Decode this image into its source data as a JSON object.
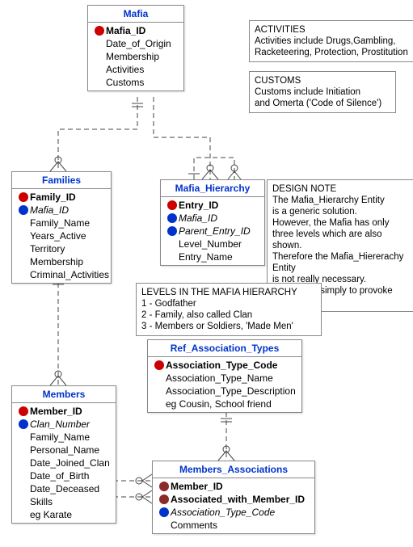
{
  "entities": {
    "mafia": {
      "title": "Mafia",
      "attrs": [
        {
          "key": "pk",
          "name": "Mafia_ID",
          "bold": true
        },
        {
          "key": null,
          "name": "Date_of_Origin"
        },
        {
          "key": null,
          "name": "Membership"
        },
        {
          "key": null,
          "name": "Activities"
        },
        {
          "key": null,
          "name": "Customs"
        }
      ]
    },
    "families": {
      "title": "Families",
      "attrs": [
        {
          "key": "pk",
          "name": "Family_ID",
          "bold": true
        },
        {
          "key": "fk",
          "name": "Mafia_ID",
          "italic": true
        },
        {
          "key": null,
          "name": "Family_Name"
        },
        {
          "key": null,
          "name": "Years_Active"
        },
        {
          "key": null,
          "name": "Territory"
        },
        {
          "key": null,
          "name": "Membership"
        },
        {
          "key": null,
          "name": "Criminal_Activities"
        }
      ]
    },
    "hierarchy": {
      "title": "Mafia_Hierarchy",
      "attrs": [
        {
          "key": "pk",
          "name": "Entry_ID",
          "bold": true
        },
        {
          "key": "fk",
          "name": "Mafia_ID",
          "italic": true
        },
        {
          "key": "fk",
          "name": "Parent_Entry_ID",
          "italic": true
        },
        {
          "key": null,
          "name": "Level_Number"
        },
        {
          "key": null,
          "name": "Entry_Name"
        }
      ]
    },
    "members": {
      "title": "Members",
      "attrs": [
        {
          "key": "pk",
          "name": "Member_ID",
          "bold": true
        },
        {
          "key": "fk",
          "name": "Clan_Number",
          "italic": true
        },
        {
          "key": null,
          "name": "Family_Name"
        },
        {
          "key": null,
          "name": "Personal_Name"
        },
        {
          "key": null,
          "name": "Date_Joined_Clan"
        },
        {
          "key": null,
          "name": "Date_of_Birth"
        },
        {
          "key": null,
          "name": "Date_Deceased"
        },
        {
          "key": null,
          "name": "Skills"
        },
        {
          "key": null,
          "name": "eg Karate"
        }
      ]
    },
    "ref_assoc": {
      "title": "Ref_Association_Types",
      "attrs": [
        {
          "key": "pk",
          "name": "Association_Type_Code",
          "bold": true
        },
        {
          "key": null,
          "name": "Association_Type_Name"
        },
        {
          "key": null,
          "name": "Association_Type_Description"
        },
        {
          "key": null,
          "name": "eg Cousin, School friend"
        }
      ]
    },
    "mem_assoc": {
      "title": "Members_Associations",
      "attrs": [
        {
          "key": "pf",
          "name": "Member_ID",
          "bold": true
        },
        {
          "key": "pf",
          "name": "Associated_with_Member_ID",
          "bold": true
        },
        {
          "key": "fk",
          "name": "Association_Type_Code",
          "italic": true
        },
        {
          "key": null,
          "name": "Comments"
        }
      ]
    }
  },
  "notes": {
    "activities": {
      "title": "ACTIVITIES",
      "lines": [
        "Activities include Drugs,Gambling,",
        "Racketeering, Protection, Prostitution"
      ]
    },
    "customs": {
      "title": "CUSTOMS",
      "lines": [
        "Customs include Initiation",
        "and Omerta ('Code of Silence')"
      ]
    },
    "design": {
      "title": "DESIGN NOTE",
      "lines": [
        "The Mafia_Hierarchy Entity",
        "is a generic solution.",
        "However, the Mafia has only",
        "three levels which are also shown.",
        "Therefore the Mafia_Hiererachy Entity",
        "is not really necessary.",
        "We show it simply to provoke thinkling."
      ]
    },
    "levels": {
      "title": "LEVELS IN THE MAFIA HIERARCHY",
      "lines": [
        "1 - Godfather",
        "2 - Family, also called Clan",
        "3 - Members or Soldiers, 'Made Men'"
      ]
    }
  }
}
